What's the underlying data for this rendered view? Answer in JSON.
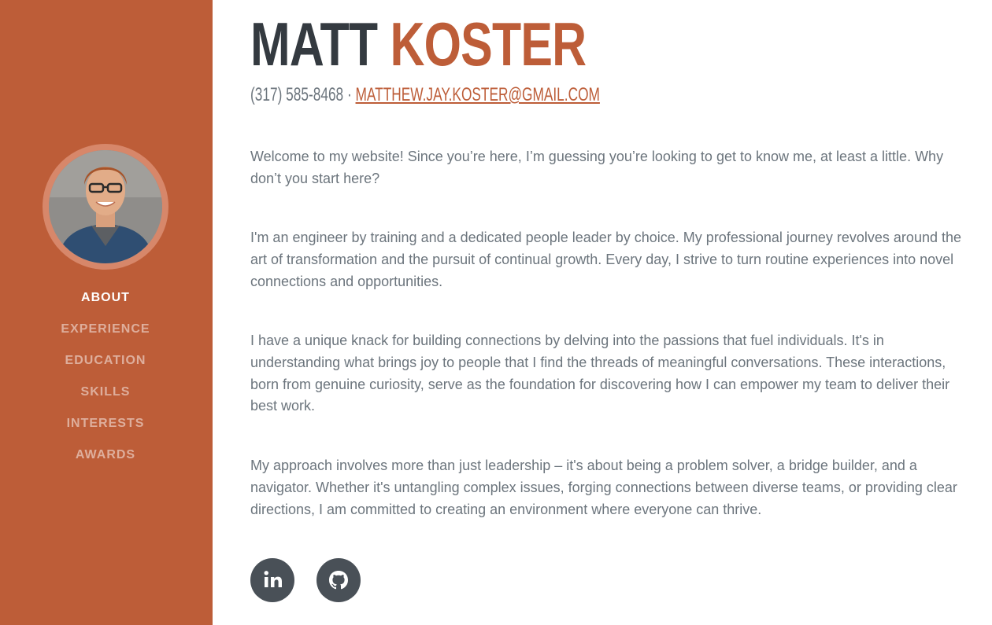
{
  "header": {
    "first_name": "MATT",
    "last_name": "KOSTER",
    "phone": "(317) 585-8468",
    "separator": " · ",
    "email": "MATTHEW.JAY.KOSTER@GMAIL.COM"
  },
  "nav": {
    "items": [
      {
        "label": "ABOUT",
        "active": true
      },
      {
        "label": "EXPERIENCE",
        "active": false
      },
      {
        "label": "EDUCATION",
        "active": false
      },
      {
        "label": "SKILLS",
        "active": false
      },
      {
        "label": "INTERESTS",
        "active": false
      },
      {
        "label": "AWARDS",
        "active": false
      }
    ]
  },
  "about": {
    "paragraphs": [
      "Welcome to my website! Since you’re here, I’m guessing you’re looking to get to know me, at least a little. Why don’t you start here?",
      "I'm an engineer by training and a dedicated people leader by choice. My professional journey revolves around the art of transformation and the pursuit of continual growth. Every day, I strive to turn routine experiences into novel connections and opportunities.",
      "I have a unique knack for building connections by delving into the passions that fuel individuals. It's in understanding what brings joy to people that I find the threads of meaningful conversations. These interactions, born from genuine curiosity, serve as the foundation for discovering how I can empower my team to deliver their best work.",
      "My approach involves more than just leadership – it's about being a problem solver, a bridge builder, and a navigator. Whether it's untangling complex issues, forging connections between diverse teams, or providing clear directions, I am committed to creating an environment where everyone can thrive."
    ]
  },
  "socials": [
    {
      "icon": "linkedin-icon"
    },
    {
      "icon": "github-icon"
    }
  ],
  "colors": {
    "primary": "#bd5d38",
    "heading": "#343a40",
    "body_text": "#6c757d",
    "social_bg": "#495057",
    "avatar_border": "#d7876a"
  }
}
